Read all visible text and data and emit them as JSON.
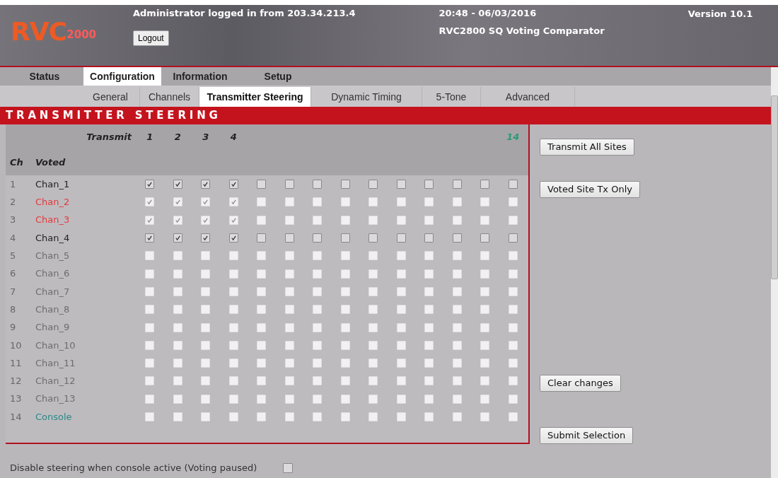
{
  "header": {
    "logo": {
      "main": "RVC",
      "sub": "2000"
    },
    "login_text": "Administrator logged in from 203.34.213.4",
    "logout_button": "Logout",
    "datetime": "20:48 - 06/03/2016",
    "product": "RVC2800 SQ Voting Comparator",
    "version": "Version 10.1"
  },
  "nav_tabs": [
    {
      "label": "Status",
      "selected": false
    },
    {
      "label": "Configuration",
      "selected": true
    },
    {
      "label": "Information",
      "selected": false
    },
    {
      "label": "Setup",
      "selected": false
    }
  ],
  "sub_tabs": [
    {
      "label": "General",
      "selected": false
    },
    {
      "label": "Channels",
      "selected": false
    },
    {
      "label": "Transmitter Steering",
      "selected": true
    },
    {
      "label": "Dynamic Timing",
      "selected": false
    },
    {
      "label": "5-Tone",
      "selected": false
    },
    {
      "label": "Advanced",
      "selected": false
    }
  ],
  "section_title": "TRANSMITTER STEERING",
  "table": {
    "transmit_label": "Transmit",
    "ch_label": "Ch",
    "voted_label": "Voted",
    "columns": [
      {
        "label": "1",
        "color": "#222222"
      },
      {
        "label": "2",
        "color": "#222222"
      },
      {
        "label": "3",
        "color": "#222222"
      },
      {
        "label": "4",
        "color": "#222222"
      },
      {},
      {},
      {},
      {},
      {},
      {},
      {},
      {},
      {},
      {
        "label": "14",
        "color": "#2a9a7a"
      }
    ],
    "rows": [
      {
        "ch": "1",
        "name": "Chan_1",
        "color": "#222222",
        "disabled": false,
        "checked": [
          true,
          true,
          true,
          true,
          false,
          false,
          false,
          false,
          false,
          false,
          false,
          false,
          false,
          false
        ]
      },
      {
        "ch": "2",
        "name": "Chan_2",
        "color": "#e23a3a",
        "disabled": true,
        "checked": [
          true,
          true,
          true,
          true,
          false,
          false,
          false,
          false,
          false,
          false,
          false,
          false,
          false,
          false
        ]
      },
      {
        "ch": "3",
        "name": "Chan_3",
        "color": "#e23a3a",
        "disabled": true,
        "checked": [
          true,
          true,
          true,
          true,
          false,
          false,
          false,
          false,
          false,
          false,
          false,
          false,
          false,
          false
        ]
      },
      {
        "ch": "4",
        "name": "Chan_4",
        "color": "#222222",
        "disabled": false,
        "checked": [
          true,
          true,
          true,
          true,
          false,
          false,
          false,
          false,
          false,
          false,
          false,
          false,
          false,
          false
        ]
      },
      {
        "ch": "5",
        "name": "Chan_5",
        "color": "#6e6c6e",
        "disabled": true,
        "checked": [
          false,
          false,
          false,
          false,
          false,
          false,
          false,
          false,
          false,
          false,
          false,
          false,
          false,
          false
        ]
      },
      {
        "ch": "6",
        "name": "Chan_6",
        "color": "#6e6c6e",
        "disabled": true,
        "checked": [
          false,
          false,
          false,
          false,
          false,
          false,
          false,
          false,
          false,
          false,
          false,
          false,
          false,
          false
        ]
      },
      {
        "ch": "7",
        "name": "Chan_7",
        "color": "#6e6c6e",
        "disabled": true,
        "checked": [
          false,
          false,
          false,
          false,
          false,
          false,
          false,
          false,
          false,
          false,
          false,
          false,
          false,
          false
        ]
      },
      {
        "ch": "8",
        "name": "Chan_8",
        "color": "#6e6c6e",
        "disabled": true,
        "checked": [
          false,
          false,
          false,
          false,
          false,
          false,
          false,
          false,
          false,
          false,
          false,
          false,
          false,
          false
        ]
      },
      {
        "ch": "9",
        "name": "Chan_9",
        "color": "#6e6c6e",
        "disabled": true,
        "checked": [
          false,
          false,
          false,
          false,
          false,
          false,
          false,
          false,
          false,
          false,
          false,
          false,
          false,
          false
        ]
      },
      {
        "ch": "10",
        "name": "Chan_10",
        "color": "#6e6c6e",
        "disabled": true,
        "checked": [
          false,
          false,
          false,
          false,
          false,
          false,
          false,
          false,
          false,
          false,
          false,
          false,
          false,
          false
        ]
      },
      {
        "ch": "11",
        "name": "Chan_11",
        "color": "#6e6c6e",
        "disabled": true,
        "checked": [
          false,
          false,
          false,
          false,
          false,
          false,
          false,
          false,
          false,
          false,
          false,
          false,
          false,
          false
        ]
      },
      {
        "ch": "12",
        "name": "Chan_12",
        "color": "#6e6c6e",
        "disabled": true,
        "checked": [
          false,
          false,
          false,
          false,
          false,
          false,
          false,
          false,
          false,
          false,
          false,
          false,
          false,
          false
        ]
      },
      {
        "ch": "13",
        "name": "Chan_13",
        "color": "#6e6c6e",
        "disabled": true,
        "checked": [
          false,
          false,
          false,
          false,
          false,
          false,
          false,
          false,
          false,
          false,
          false,
          false,
          false,
          false
        ]
      },
      {
        "ch": "14",
        "name": "Console",
        "color": "#2a8a8a",
        "disabled": true,
        "checked": [
          false,
          false,
          false,
          false,
          false,
          false,
          false,
          false,
          false,
          false,
          false,
          false,
          false,
          false
        ]
      }
    ]
  },
  "side_buttons": [
    "Transmit All Sites",
    "Voted Site Tx Only",
    "Clear changes",
    "Submit Selection"
  ],
  "disable_option": {
    "label": "Disable steering when console active (Voting paused)",
    "checked": false
  }
}
